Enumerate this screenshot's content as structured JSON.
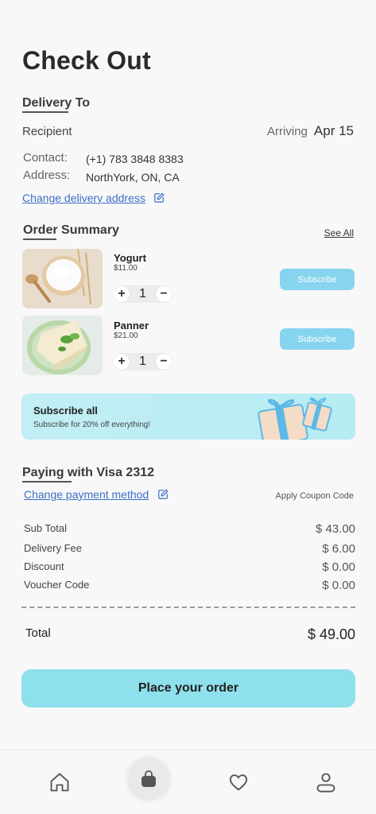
{
  "page": {
    "title": "Check Out"
  },
  "delivery": {
    "heading": "Delivery To",
    "recipient_label": "Recipient",
    "arriving_label": "Arriving",
    "arriving_date": "Apr 15",
    "contact_label": "Contact:",
    "contact_value": "(+1) 783 3848 8383",
    "address_label": "Address:",
    "address_value": "NorthYork, ON, CA",
    "change_link": "Change delivery address"
  },
  "order": {
    "heading": "Order Summary",
    "see_all": "See All",
    "items": [
      {
        "name": "Yogurt",
        "price": "$11.00",
        "qty": "1",
        "subscribe_label": "Subscribe"
      },
      {
        "name": "Panner",
        "price": "$21.00",
        "qty": "1",
        "subscribe_label": "Subscribe"
      }
    ]
  },
  "banner": {
    "title": "Subscribe all",
    "subtitle": "Subscribe for 20% off everything!"
  },
  "payment": {
    "heading": "Paying with Visa 2312",
    "change_link": "Change payment method",
    "coupon_link": "Apply Coupon Code"
  },
  "summary": {
    "rows": [
      {
        "label": "Sub Total",
        "value": "$ 43.00"
      },
      {
        "label": "Delivery Fee",
        "value": "$ 6.00"
      },
      {
        "label": "Discount",
        "value": "$ 0.00"
      },
      {
        "label": "Voucher Code",
        "value": "$ 0.00"
      }
    ],
    "total_label": "Total",
    "total_value": "$ 49.00"
  },
  "cta": {
    "label": "Place your order"
  },
  "nav": {
    "items": [
      {
        "icon": "home-icon",
        "active": false
      },
      {
        "icon": "bag-icon",
        "active": true
      },
      {
        "icon": "heart-icon",
        "active": false
      },
      {
        "icon": "profile-icon",
        "active": false
      }
    ]
  },
  "colors": {
    "accent": "#8ee0ec",
    "subscribe": "#87d4ee",
    "link": "#3b6fc7",
    "banner": "#c2eef5"
  }
}
